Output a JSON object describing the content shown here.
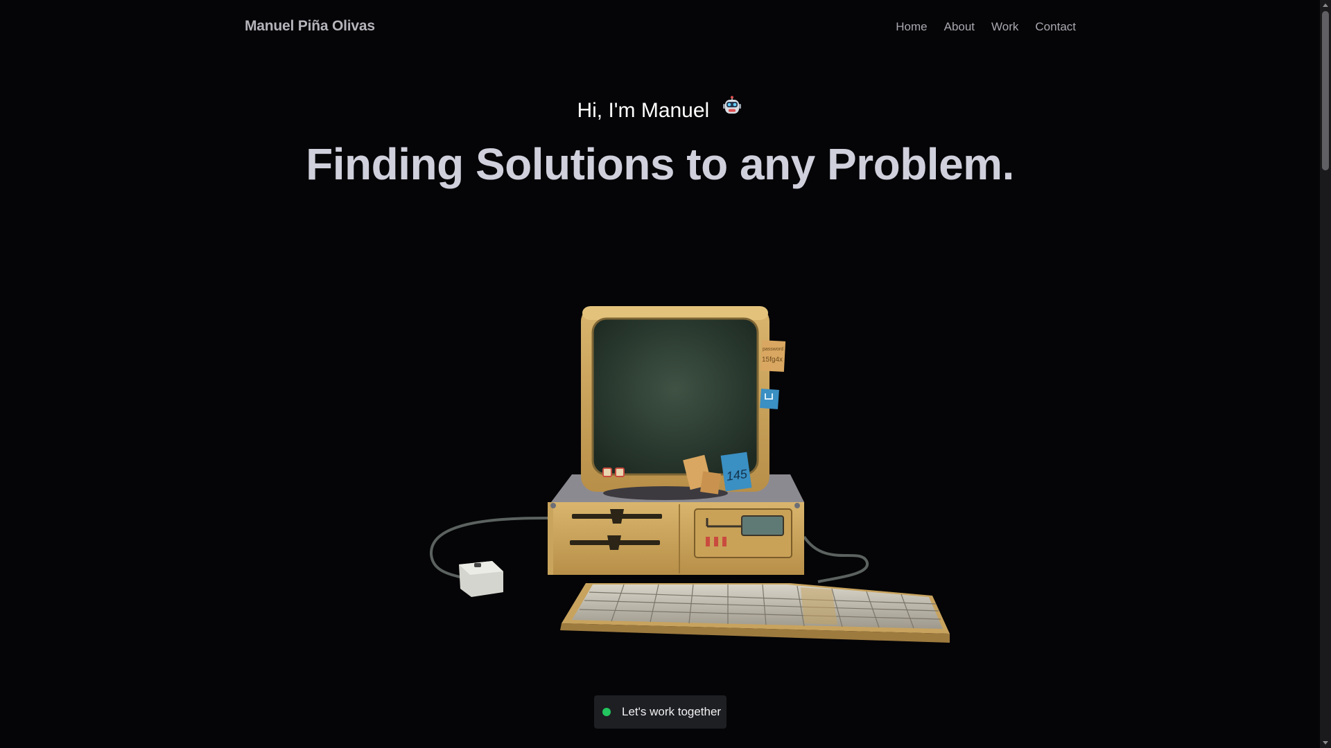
{
  "header": {
    "brand": "Manuel Piña Olivas",
    "nav": [
      "Home",
      "About",
      "Work",
      "Contact"
    ]
  },
  "hero": {
    "greeting": "Hi, I'm Manuel",
    "greeting_icon": "robot-emoji-icon",
    "headline": "Finding Solutions to any Problem."
  },
  "illustration": {
    "name": "retro-computer-3d",
    "sticky_notes": [
      "password",
      "15fg4x",
      "145"
    ]
  },
  "cta": {
    "label": "Let's work together",
    "status_color": "#22c55e"
  },
  "colors": {
    "background": "#050507",
    "headline": "#cfd0dc",
    "nav_text": "#a9a9b1"
  }
}
